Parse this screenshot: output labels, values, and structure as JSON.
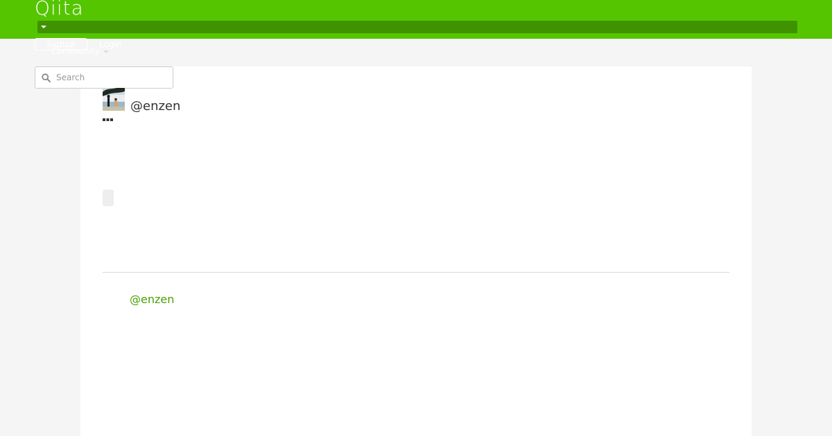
{
  "header": {
    "logo_text": "Qiita",
    "signup_label": "Signup",
    "login_label": "Login",
    "community_label": "Community",
    "brand_color": "#55c500"
  },
  "search": {
    "placeholder": "Search",
    "value": ""
  },
  "article": {
    "author_handle": "@enzen",
    "author_link": "@enzen"
  },
  "icons": {
    "menu": "caret-down-icon",
    "search": "search-icon",
    "more": "more-icon"
  }
}
